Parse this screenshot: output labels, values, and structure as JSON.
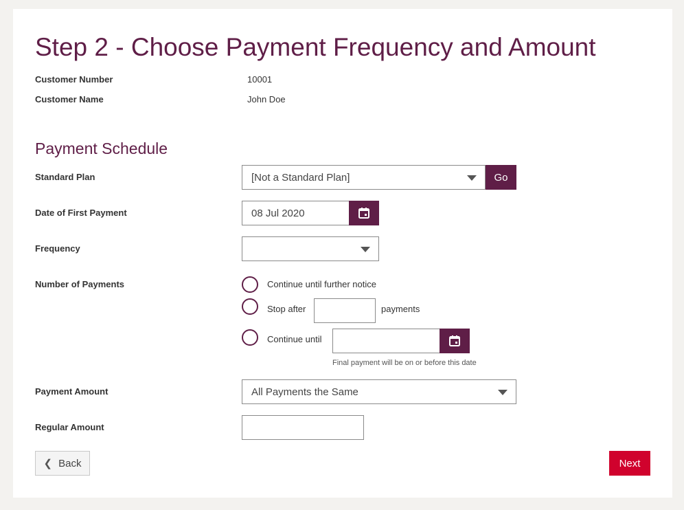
{
  "page": {
    "title": "Step 2 - Choose Payment Frequency and Amount"
  },
  "customer": {
    "number_label": "Customer Number",
    "number_value": "10001",
    "name_label": "Customer Name",
    "name_value": "John Doe"
  },
  "schedule": {
    "section_title": "Payment Schedule",
    "standard_plan": {
      "label": "Standard Plan",
      "selected": "[Not a Standard Plan]",
      "go_label": "Go"
    },
    "first_payment": {
      "label": "Date of First Payment",
      "value": "08 Jul 2020",
      "icon": "calendar-icon"
    },
    "frequency": {
      "label": "Frequency",
      "selected": ""
    },
    "number_of_payments": {
      "label": "Number of Payments",
      "option_continue": "Continue until further notice",
      "option_stop_after": "Stop after",
      "stop_after_suffix": "payments",
      "stop_after_value": "",
      "option_continue_until": "Continue until",
      "continue_until_value": "",
      "continue_until_hint": "Final payment will be on or before this date"
    },
    "payment_amount": {
      "label": "Payment Amount",
      "selected": "All Payments the Same"
    },
    "regular_amount": {
      "label": "Regular Amount",
      "value": ""
    }
  },
  "footer": {
    "back_label": "Back",
    "next_label": "Next"
  },
  "colors": {
    "brand_purple": "#5f1e47",
    "next_red": "#d0022d",
    "background": "#f3f2ef"
  }
}
